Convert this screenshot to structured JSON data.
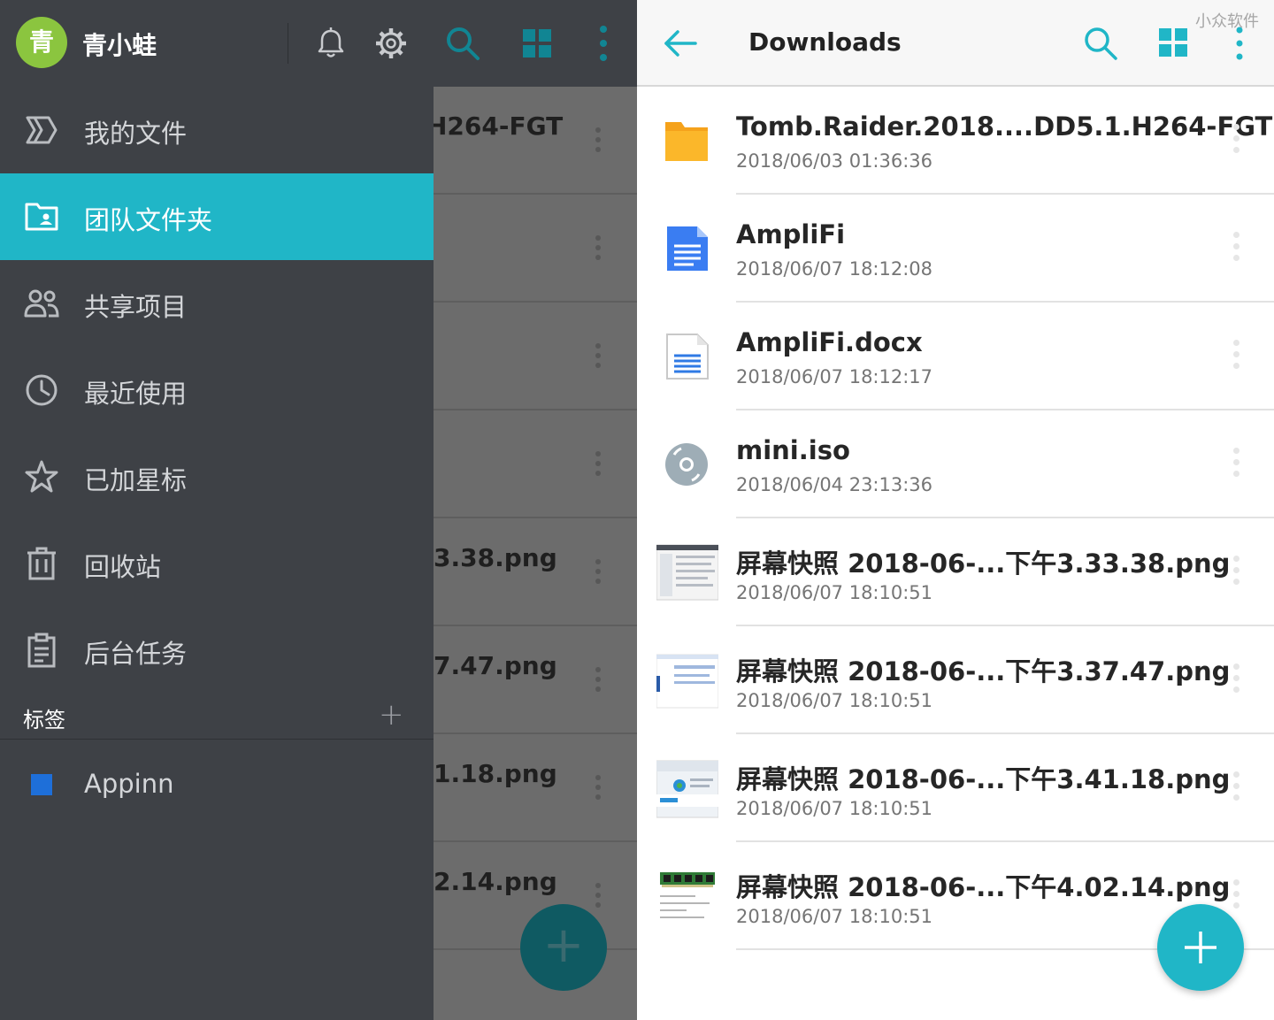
{
  "drawer": {
    "avatar_char": "青",
    "username": "青小蛙",
    "nav": [
      {
        "label": "我的文件",
        "icon": "my-files-icon",
        "active": false
      },
      {
        "label": "团队文件夹",
        "icon": "team-folder-icon",
        "active": true
      },
      {
        "label": "共享项目",
        "icon": "people-icon",
        "active": false
      },
      {
        "label": "最近使用",
        "icon": "clock-icon",
        "active": false
      },
      {
        "label": "已加星标",
        "icon": "star-icon",
        "active": false
      },
      {
        "label": "回收站",
        "icon": "trash-icon",
        "active": false
      },
      {
        "label": "后台任务",
        "icon": "clipboard-icon",
        "active": false
      }
    ],
    "tags_label": "标签",
    "tags_add": "+",
    "tag": {
      "label": "Appinn",
      "color": "#1e6fd9"
    }
  },
  "dimmed_list": {
    "rows": [
      "H264-FGT",
      "",
      "",
      "",
      "3.38.png",
      "7.47.png",
      "1.18.png",
      "2.14.png"
    ]
  },
  "right": {
    "title": "Downloads",
    "watermark": "小众软件",
    "accent": "#20b6c7",
    "files": [
      {
        "name": "Tomb.Raider.2018....DD5.1.H264-FGT",
        "date": "2018/06/03 01:36:36",
        "type": "folder"
      },
      {
        "name": "AmpliFi",
        "date": "2018/06/07 18:12:08",
        "type": "gdoc"
      },
      {
        "name": "AmpliFi.docx",
        "date": "2018/06/07 18:12:17",
        "type": "docx"
      },
      {
        "name": "mini.iso",
        "date": "2018/06/04 23:13:36",
        "type": "disc"
      },
      {
        "name": "屏幕快照 2018-06-...下午3.33.38.png",
        "date": "2018/06/07 18:10:51",
        "type": "thumb1"
      },
      {
        "name": "屏幕快照 2018-06-...下午3.37.47.png",
        "date": "2018/06/07 18:10:51",
        "type": "thumb2"
      },
      {
        "name": "屏幕快照 2018-06-...下午3.41.18.png",
        "date": "2018/06/07 18:10:51",
        "type": "thumb3"
      },
      {
        "name": "屏幕快照 2018-06-...下午4.02.14.png",
        "date": "2018/06/07 18:10:51",
        "type": "thumb4"
      }
    ]
  }
}
